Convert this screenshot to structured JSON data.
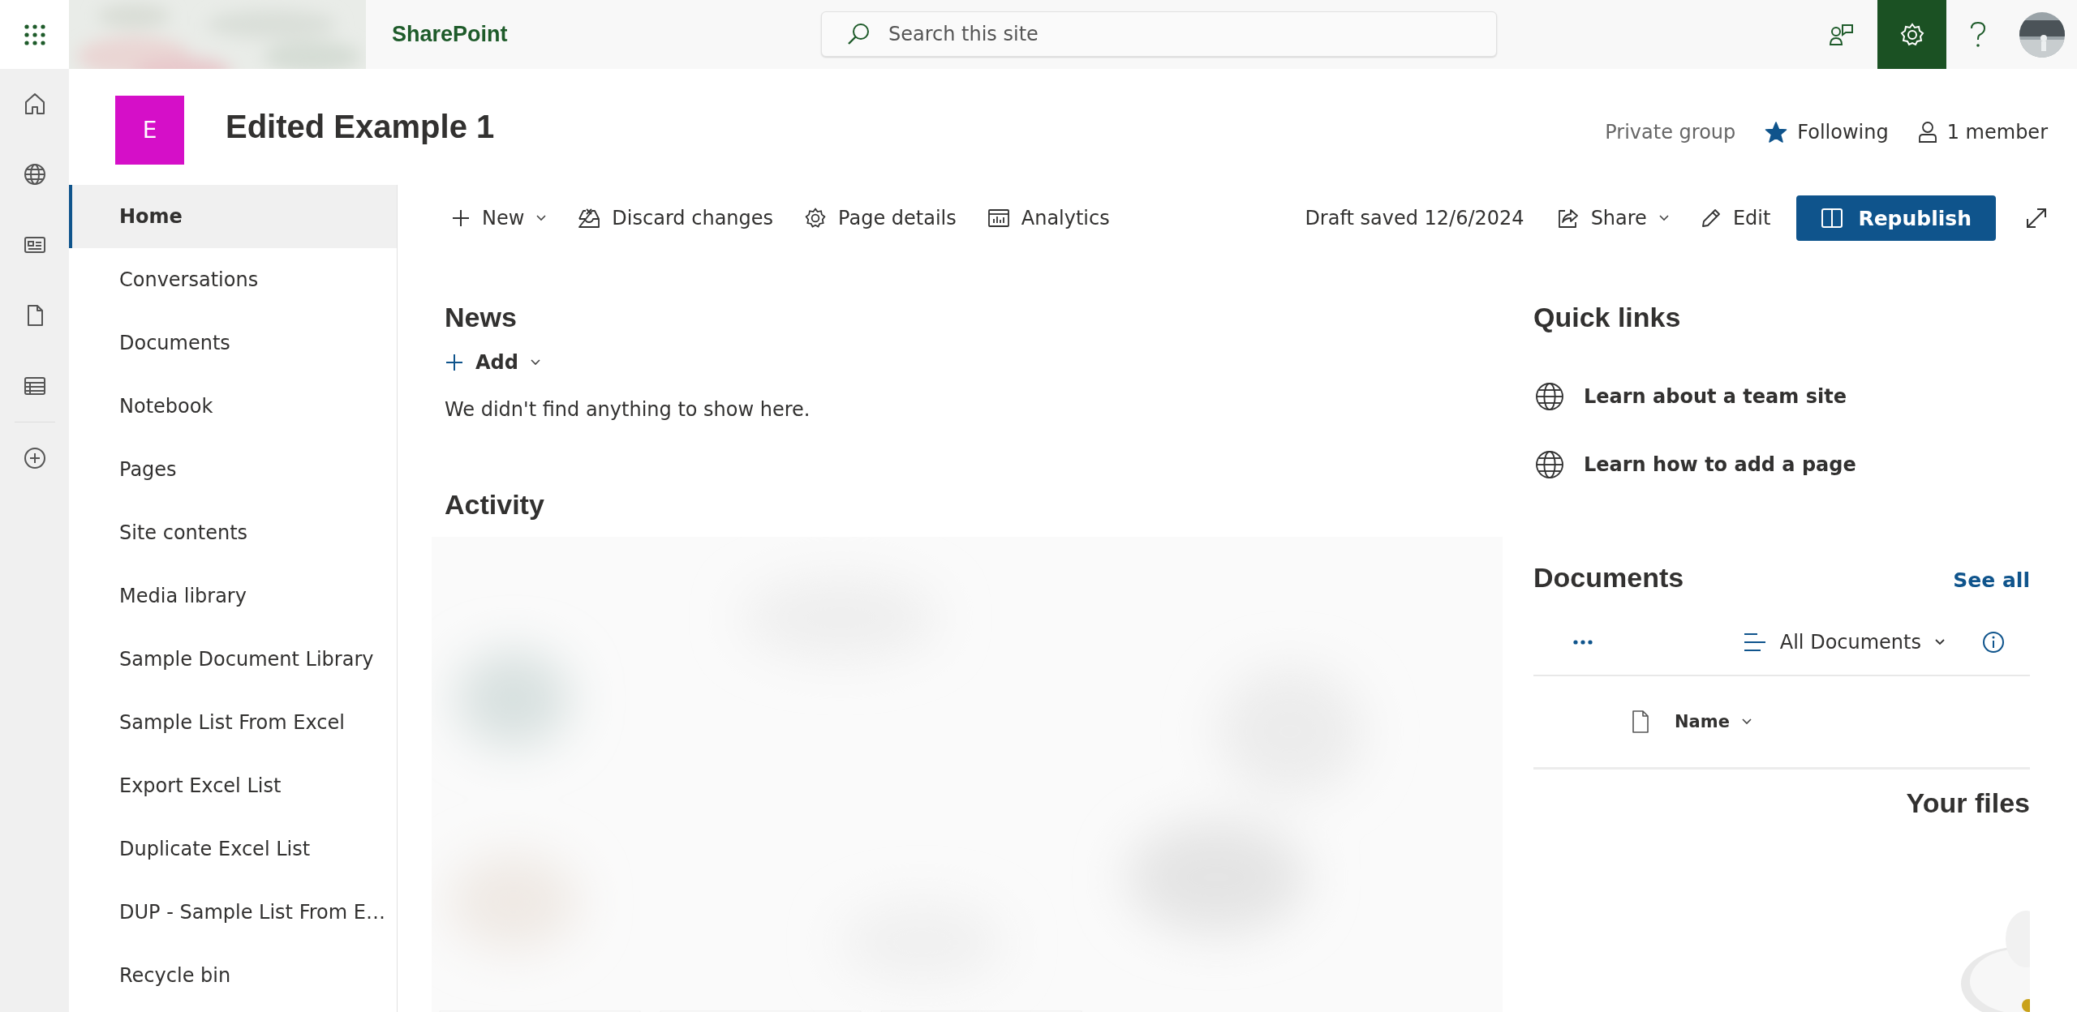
{
  "app_bar": {
    "app_name": "SharePoint",
    "search": {
      "placeholder": "Search this site"
    }
  },
  "site": {
    "initial": "E",
    "title": "Edited Example 1",
    "privacy": "Private group",
    "following": {
      "label": "Following",
      "on": true
    },
    "members": "1 member"
  },
  "nav": [
    {
      "label": "Home",
      "selected": true
    },
    {
      "label": "Conversations",
      "selected": false
    },
    {
      "label": "Documents",
      "selected": false
    },
    {
      "label": "Notebook",
      "selected": false
    },
    {
      "label": "Pages",
      "selected": false
    },
    {
      "label": "Site contents",
      "selected": false
    },
    {
      "label": "Media library",
      "selected": false
    },
    {
      "label": "Sample Document Library",
      "selected": false
    },
    {
      "label": "Sample List From Excel",
      "selected": false
    },
    {
      "label": "Export Excel List",
      "selected": false
    },
    {
      "label": "Duplicate Excel List",
      "selected": false
    },
    {
      "label": "DUP - Sample List From E…",
      "selected": false
    },
    {
      "label": "Recycle bin",
      "selected": false
    }
  ],
  "command_bar": {
    "left": [
      {
        "kind": "new",
        "label": "New",
        "dropdown": true
      },
      {
        "kind": "discard",
        "label": "Discard changes",
        "dropdown": false
      },
      {
        "kind": "details",
        "label": "Page details",
        "dropdown": false
      },
      {
        "kind": "analytics",
        "label": "Analytics",
        "dropdown": false
      }
    ],
    "status": "Draft saved 12/6/2024",
    "right": [
      {
        "kind": "share",
        "label": "Share",
        "dropdown": true
      },
      {
        "kind": "edit",
        "label": "Edit",
        "dropdown": false
      }
    ],
    "primary": "Republish"
  },
  "news": {
    "title": "News",
    "add": "Add",
    "empty": "We didn't find anything to show here."
  },
  "activity": {
    "title": "Activity"
  },
  "quick_links": {
    "title": "Quick links",
    "items": [
      "Learn about a team site",
      "Learn how to add a page"
    ]
  },
  "documents": {
    "title": "Documents",
    "see_all": "See all",
    "view": "All Documents",
    "column": "Name",
    "empty_title": "Your files"
  }
}
